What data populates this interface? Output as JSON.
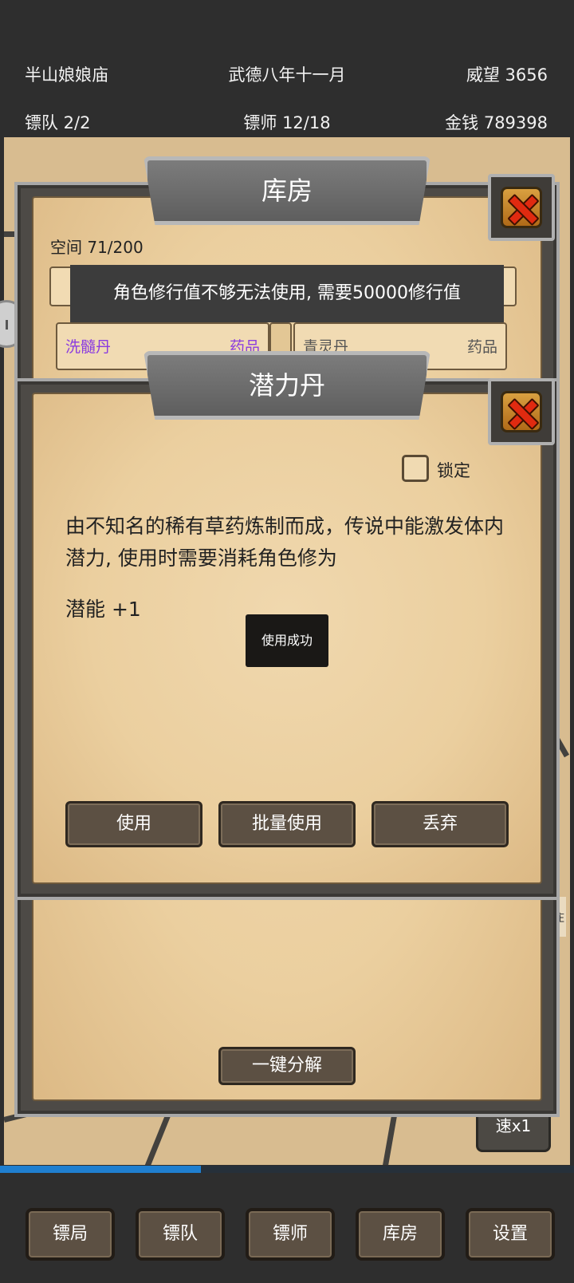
{
  "status": {
    "location": "半山娘娘庙",
    "date": "武德八年十一月",
    "prestige": "威望 3656",
    "convoy": "镖队 2/2",
    "escorts": "镖师 12/18",
    "money": "金钱  789398"
  },
  "map": {
    "speed_label": "速x1",
    "village_label": "庄",
    "progress": 0.35
  },
  "warehouse": {
    "title": "库房",
    "space": "空间 71/200",
    "toast": "角色修行值不够无法使用, 需要50000修行值",
    "items": [
      {
        "name": "洗髓丹",
        "type": "药品",
        "color": "#8a3be0"
      },
      {
        "name": "青灵丹",
        "type": "药品",
        "color": "#555555"
      }
    ],
    "decompose_label": "一键分解"
  },
  "item_detail": {
    "title": "潜力丹",
    "lock_label": "锁定",
    "description": "由不知名的稀有草药炼制而成，传说中能激发体内潜力, 使用时需要消耗角色修为",
    "effect": "潜能 +1",
    "toast": "使用成功",
    "use_label": "使用",
    "batch_use_label": "批量使用",
    "discard_label": "丢弃"
  },
  "tabs": [
    "镖局",
    "镖队",
    "镖师",
    "库房",
    "设置"
  ]
}
